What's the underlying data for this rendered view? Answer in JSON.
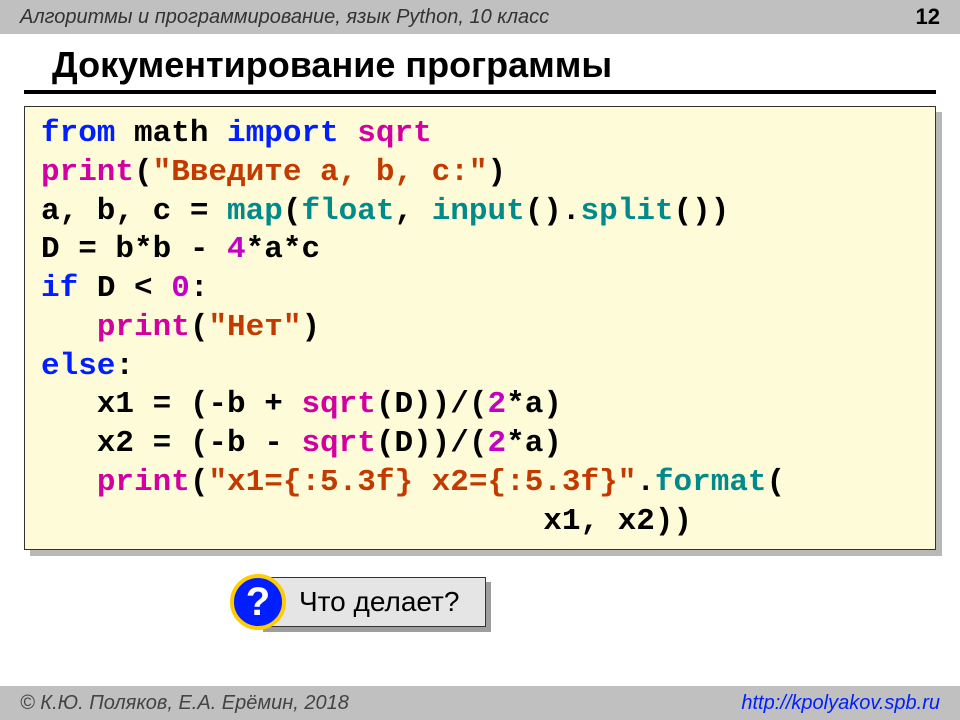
{
  "header": {
    "course": "Алгоритмы и программирование, язык Python, 10 класс",
    "page": "12"
  },
  "title": "Документирование программы",
  "code": {
    "l1": {
      "p1": "from",
      "p2": " math ",
      "p3": "import",
      "p4": " sqrt"
    },
    "l2": {
      "p1": "print",
      "p2": "(",
      "p3": "\"Введите a, b, c:\"",
      "p4": ")"
    },
    "l3": {
      "p1": "a, b, c = ",
      "p2": "map",
      "p3": "(",
      "p4": "float",
      "p5": ", ",
      "p6": "input",
      "p7": "().",
      "p8": "split",
      "p9": "())"
    },
    "l4": {
      "p1": "D = b*b - ",
      "p2": "4",
      "p3": "*a*c"
    },
    "l5": {
      "p1": "if",
      "p2": " D < ",
      "p3": "0",
      "p4": ":"
    },
    "l6": {
      "p1": "   ",
      "p2": "print",
      "p3": "(",
      "p4": "\"Нет\"",
      "p5": ")"
    },
    "l7": {
      "p1": "else",
      "p2": ":"
    },
    "l8": {
      "p1": "   x1 = (-b + ",
      "p2": "sqrt",
      "p3": "(D))/(",
      "p4": "2",
      "p5": "*a)"
    },
    "l9": {
      "p1": "   x2 = (-b - ",
      "p2": "sqrt",
      "p3": "(D))/(",
      "p4": "2",
      "p5": "*a)"
    },
    "l10": {
      "p1": "   ",
      "p2": "print",
      "p3": "(",
      "p4": "\"x1={:5.3f} x2={:5.3f}\"",
      "p5": ".",
      "p6": "format",
      "p7": "("
    },
    "l11": {
      "p1": "                           x1, x2))"
    }
  },
  "question": {
    "badge": "?",
    "text": "Что делает?"
  },
  "footer": {
    "copyright": "© К.Ю. Поляков, Е.А. Ерёмин, 2018",
    "url": "http://kpolyakov.spb.ru"
  }
}
